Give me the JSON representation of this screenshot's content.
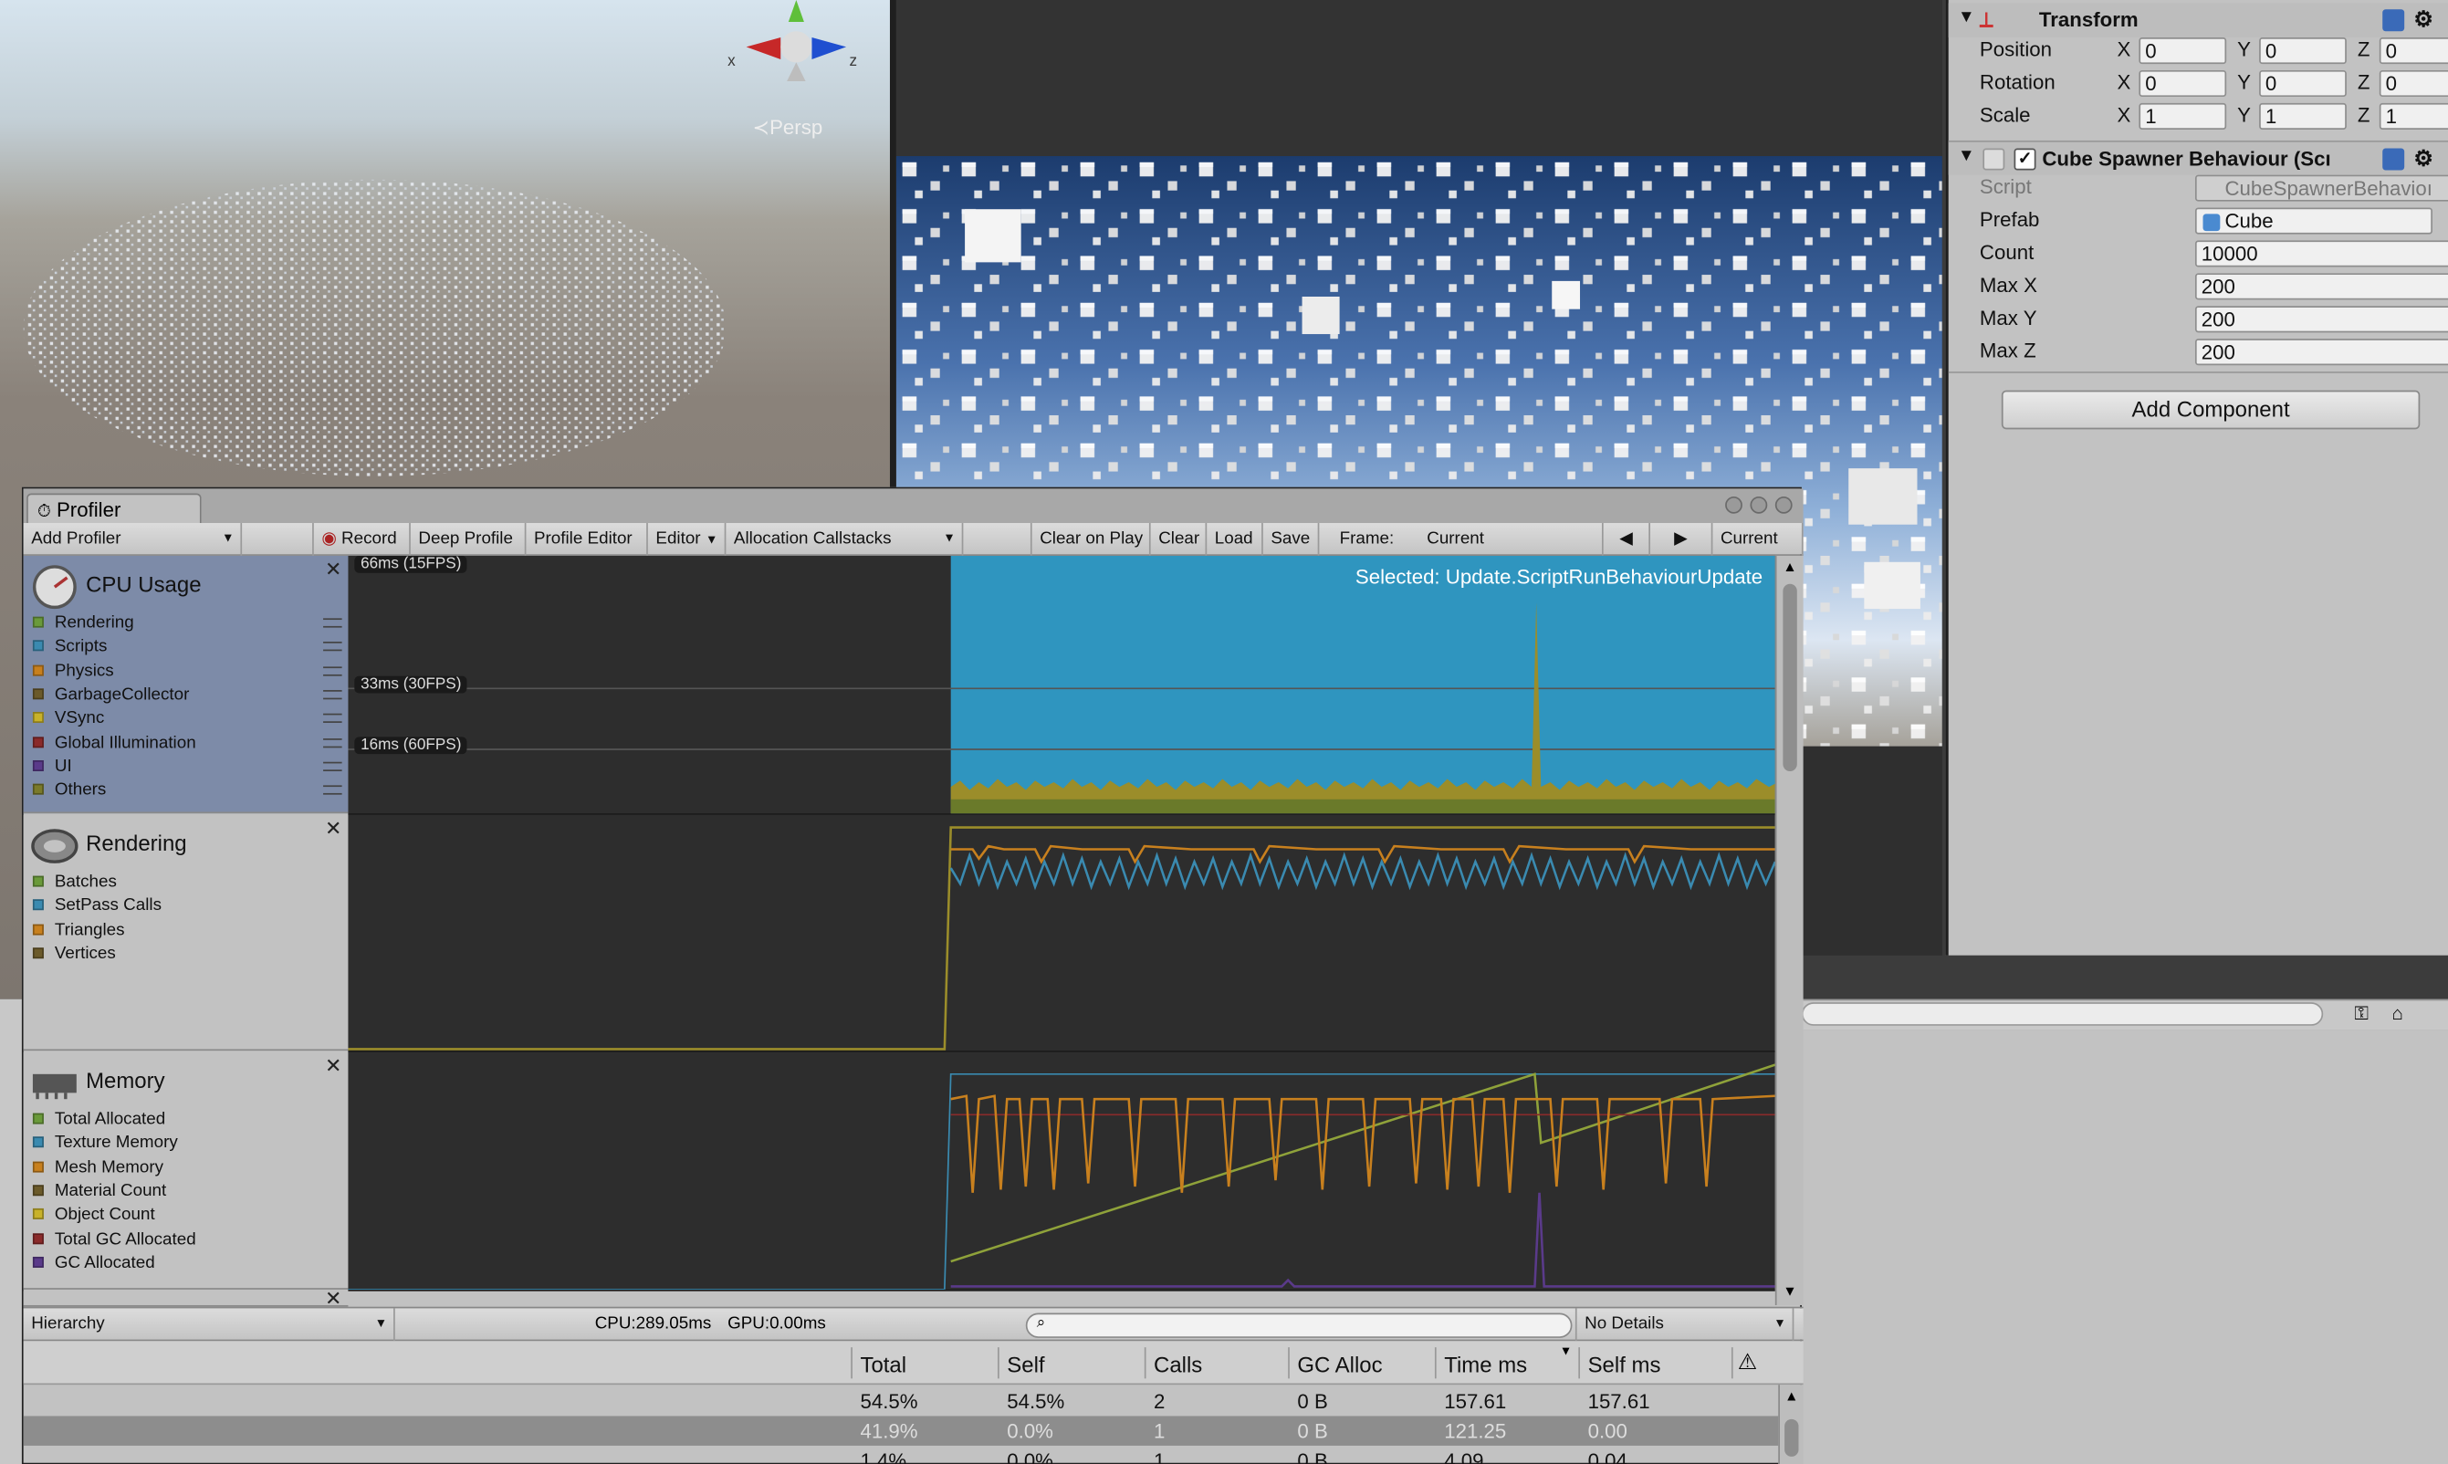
{
  "scene": {
    "persp_label": "≺Persp",
    "axis_x": "x",
    "axis_z": "z"
  },
  "inspector": {
    "transform": {
      "title": "Transform",
      "rows": [
        {
          "label": "Position",
          "x": "0",
          "y": "0",
          "z": "0"
        },
        {
          "label": "Rotation",
          "x": "0",
          "y": "0",
          "z": "0"
        },
        {
          "label": "Scale",
          "x": "1",
          "y": "1",
          "z": "1"
        }
      ],
      "axis_labels": [
        "X",
        "Y",
        "Z"
      ]
    },
    "component": {
      "title": "Cube Spawner Behaviour (Scı",
      "script_label": "Script",
      "script_value": "CubeSpawnerBehavioı",
      "prefab_label": "Prefab",
      "prefab_value": "Cube",
      "count_label": "Count",
      "count_value": "10000",
      "maxx_label": "Max X",
      "maxx_value": "200",
      "maxy_label": "Max Y",
      "maxy_value": "200",
      "maxz_label": "Max Z",
      "maxz_value": "200"
    },
    "add_component": "Add Component"
  },
  "profiler": {
    "tab_title": "Profiler",
    "toolbar": {
      "add_profiler": "Add Profiler",
      "record": "Record",
      "deep_profile": "Deep Profile",
      "profile_editor": "Profile Editor",
      "editor": "Editor",
      "allocation_callstacks": "Allocation Callstacks",
      "clear_on_play": "Clear on Play",
      "clear": "Clear",
      "load": "Load",
      "save": "Save",
      "frame_label": "Frame:",
      "frame_value": "Current",
      "current": "Current"
    },
    "cpu": {
      "title": "CPU Usage",
      "items": [
        {
          "label": "Rendering",
          "color": "#6a9a3a"
        },
        {
          "label": "Scripts",
          "color": "#3a8ab0"
        },
        {
          "label": "Physics",
          "color": "#c8801e"
        },
        {
          "label": "GarbageCollector",
          "color": "#6b5a2a"
        },
        {
          "label": "VSync",
          "color": "#c8b22a"
        },
        {
          "label": "Global Illumination",
          "color": "#8a2a2a"
        },
        {
          "label": "UI",
          "color": "#5a3a8a"
        },
        {
          "label": "Others",
          "color": "#7a7a2a"
        }
      ],
      "fps_labels": [
        "66ms (15FPS)",
        "33ms (30FPS)",
        "16ms (60FPS)"
      ],
      "selected": "Selected: Update.ScriptRunBehaviourUpdate"
    },
    "rendering": {
      "title": "Rendering",
      "items": [
        {
          "label": "Batches",
          "color": "#6a9a3a"
        },
        {
          "label": "SetPass Calls",
          "color": "#3a8ab0"
        },
        {
          "label": "Triangles",
          "color": "#c8801e"
        },
        {
          "label": "Vertices",
          "color": "#6b5a2a"
        }
      ]
    },
    "memory": {
      "title": "Memory",
      "items": [
        {
          "label": "Total Allocated",
          "color": "#6a9a3a"
        },
        {
          "label": "Texture Memory",
          "color": "#3a8ab0"
        },
        {
          "label": "Mesh Memory",
          "color": "#c8801e"
        },
        {
          "label": "Material Count",
          "color": "#6b5a2a"
        },
        {
          "label": "Object Count",
          "color": "#c8b22a"
        },
        {
          "label": "Total GC Allocated",
          "color": "#8a2a2a"
        },
        {
          "label": "GC Allocated",
          "color": "#5a3a8a"
        }
      ]
    },
    "details": {
      "view": "Hierarchy",
      "cpu_time": "CPU:289.05ms",
      "gpu_time": "GPU:0.00ms",
      "mode": "No Details"
    },
    "table": {
      "headers": [
        "Total",
        "Self",
        "Calls",
        "GC Alloc",
        "Time ms",
        "Self ms"
      ],
      "rows": [
        [
          "54.5%",
          "54.5%",
          "2",
          "0 B",
          "157.61",
          "157.61"
        ],
        [
          "41.9%",
          "0.0%",
          "1",
          "0 B",
          "121.25",
          "0.00"
        ],
        [
          "1.4%",
          "0.0%",
          "1",
          "0 B",
          "4.09",
          "0.04"
        ]
      ]
    }
  }
}
